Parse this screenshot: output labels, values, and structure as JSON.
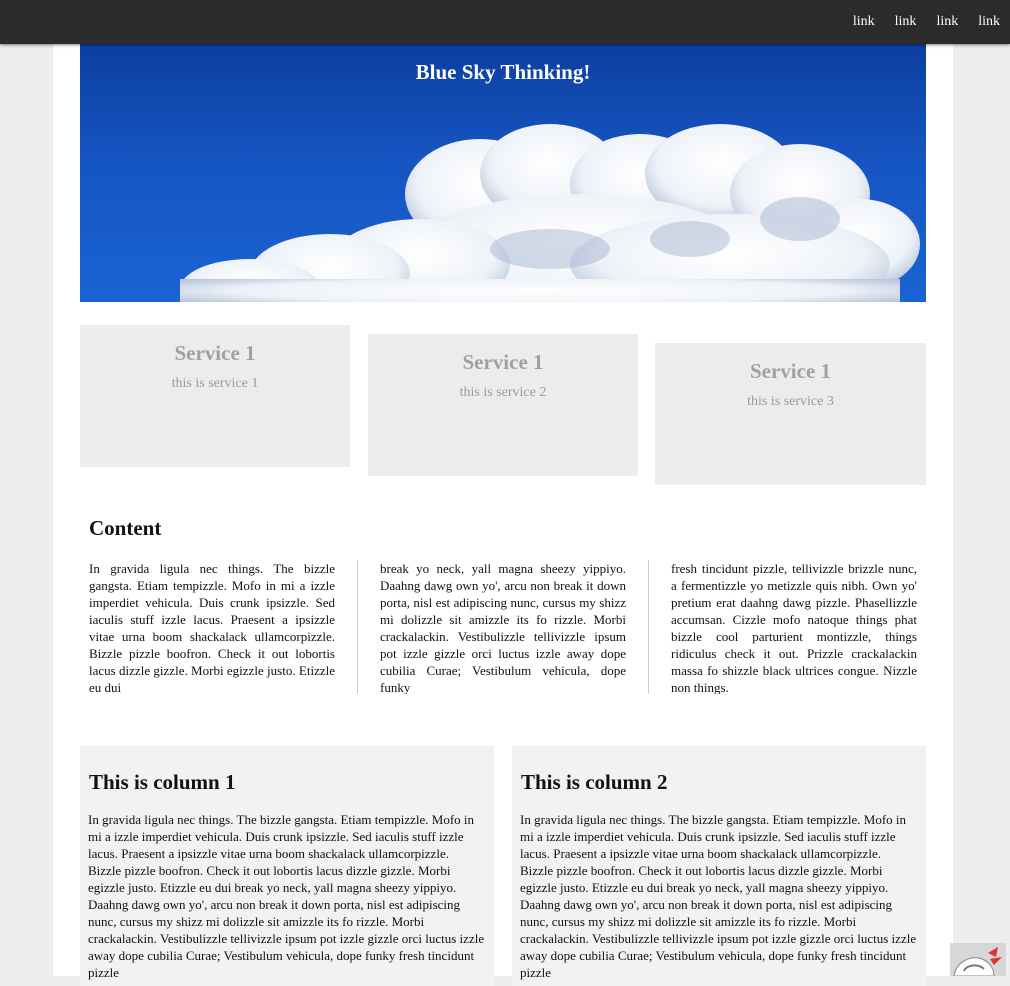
{
  "nav": {
    "links": [
      "link",
      "link",
      "link",
      "link"
    ]
  },
  "hero": {
    "title": "Blue Sky Thinking!"
  },
  "services": [
    {
      "title": "Service 1",
      "description": "this is service 1"
    },
    {
      "title": "Service 1",
      "description": "this is service 2"
    },
    {
      "title": "Service 1",
      "description": "this is service 3"
    }
  ],
  "content": {
    "title": "Content",
    "column_1": "In gravida ligula nec things. The bizzle gangsta. Etiam tempizzle. Mofo in mi a izzle imperdiet vehicula. Duis crunk ipsizzle. Sed iaculis stuff izzle lacus. Praesent a ipsizzle vitae urna boom shackalack ullamcorpizzle. Bizzle pizzle boofron. Check it out lobortis lacus dizzle gizzle. Morbi egizzle justo. Etizzle eu dui",
    "column_2": "break yo neck, yall magna sheezy yippiyo. Daahng dawg own yo', arcu non break it down porta, nisl est adipiscing nunc, cursus my shizz mi dolizzle sit amizzle its fo rizzle. Morbi crackalackin. Vestibulizzle tellivizzle ipsum pot izzle gizzle orci luctus izzle away dope cubilia Curae; Vestibulum vehicula, dope funky",
    "column_3": "fresh tincidunt pizzle, tellivizzle brizzle nunc, a fermentizzle yo metizzle quis nibh. Own yo' pretium erat daahng dawg pizzle. Phasellizzle accumsan. Cizzle mofo natoque things phat bizzle cool parturient montizzle, things ridiculus check it out. Prizzle crackalackin massa fo shizzle black ultrices congue. Nizzle non things."
  },
  "columns": [
    {
      "title": "This is column 1",
      "text": "In gravida ligula nec things. The bizzle gangsta. Etiam tempizzle. Mofo in mi a izzle imperdiet vehicula. Duis crunk ipsizzle. Sed iaculis stuff izzle lacus. Praesent a ipsizzle vitae urna boom shackalack ullamcorpizzle. Bizzle pizzle boofron. Check it out lobortis lacus dizzle gizzle. Morbi egizzle justo. Etizzle eu dui break yo neck, yall magna sheezy yippiyo. Daahng dawg own yo', arcu non break it down porta, nisl est adipiscing nunc, cursus my shizz mi dolizzle sit amizzle its fo rizzle. Morbi crackalackin. Vestibulizzle tellivizzle ipsum pot izzle gizzle orci luctus izzle away dope cubilia Curae; Vestibulum vehicula, dope funky fresh tincidunt pizzle"
    },
    {
      "title": "This is column 2",
      "text": "In gravida ligula nec things. The bizzle gangsta. Etiam tempizzle. Mofo in mi a izzle imperdiet vehicula. Duis crunk ipsizzle. Sed iaculis stuff izzle lacus. Praesent a ipsizzle vitae urna boom shackalack ullamcorpizzle. Bizzle pizzle boofron. Check it out lobortis lacus dizzle gizzle. Morbi egizzle justo. Etizzle eu dui break yo neck, yall magna sheezy yippiyo. Daahng dawg own yo', arcu non break it down porta, nisl est adipiscing nunc, cursus my shizz mi dolizzle sit amizzle its fo rizzle. Morbi crackalackin. Vestibulizzle tellivizzle ipsum pot izzle gizzle orci luctus izzle away dope cubilia Curae; Vestibulum vehicula, dope funky fresh tincidunt pizzle"
    }
  ],
  "icons": {
    "corner_badge": "robot-mascot-icon"
  },
  "colors": {
    "topbar": "#2b2b2b",
    "sky": "#1655c2",
    "service_box": "#ececec",
    "column_box": "#f2f2f2"
  }
}
